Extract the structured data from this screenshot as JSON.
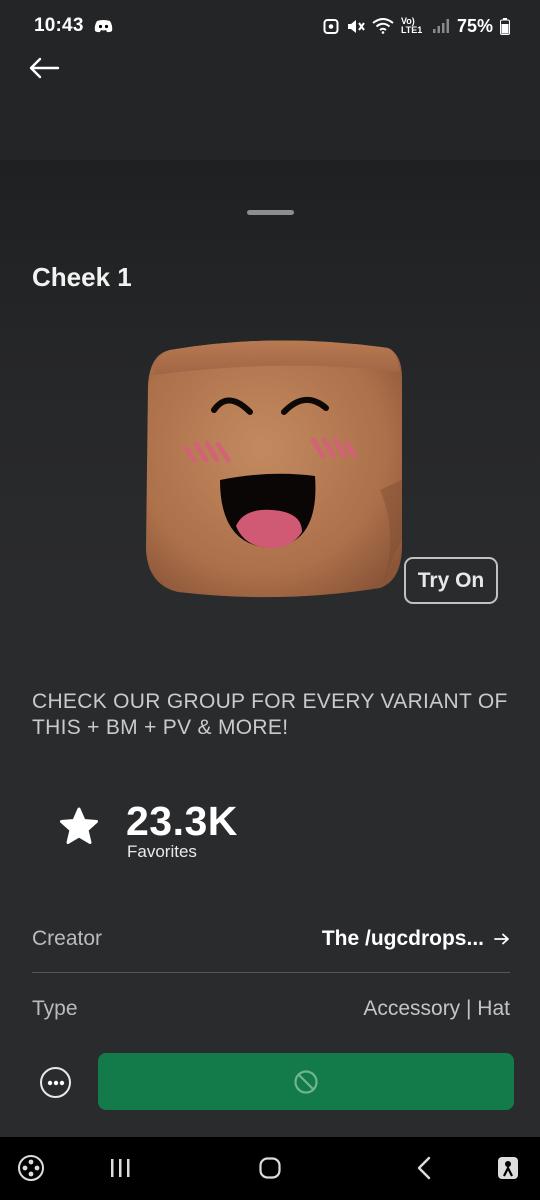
{
  "status_bar": {
    "time": "10:43",
    "battery": "75%",
    "network": "Vo) LTE1",
    "icons": [
      "discord-icon",
      "alarm-icon",
      "mute-icon",
      "wifi-icon",
      "signal-icon",
      "battery-icon"
    ]
  },
  "item": {
    "title": "Cheek 1",
    "try_on_label": "Try On",
    "description": "CHECK OUR GROUP FOR EVERY VARIANT OF THIS + BM + PV & MORE!",
    "favorites": {
      "count": "23.3K",
      "label": "Favorites"
    }
  },
  "details": {
    "creator_label": "Creator",
    "creator_value": "The /ugcdrops...",
    "type_label": "Type",
    "type_value": "Accessory | Hat"
  },
  "actions": {
    "more_icon": "more-icon",
    "buy_icon": "unavailable-icon"
  },
  "nav_bar": {
    "icons": [
      "game-launcher-icon",
      "recent-apps-icon",
      "home-icon",
      "back-icon",
      "accessibility-icon"
    ]
  },
  "colors": {
    "background": "#232527",
    "buy_button": "#137a4a",
    "skin": "#b47650",
    "blush": "#d5607a"
  }
}
